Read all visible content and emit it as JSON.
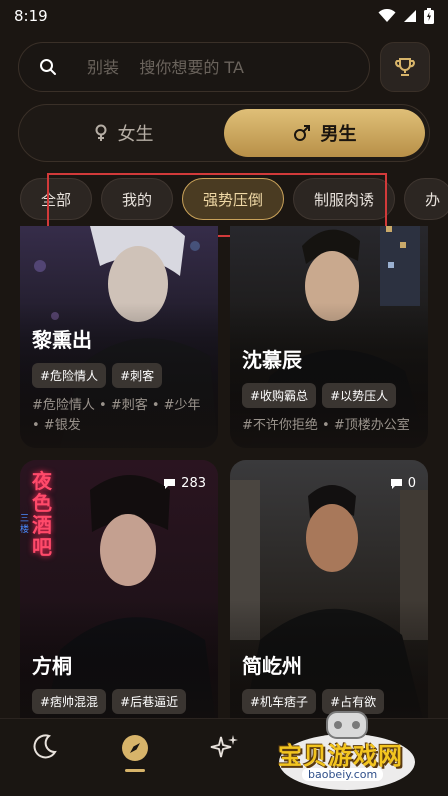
{
  "status_bar": {
    "time": "8:19"
  },
  "search": {
    "placeholder": "别装    搜你想要的 TA"
  },
  "gender": {
    "female_label": "女生",
    "male_label": "男生",
    "selected": "男生"
  },
  "categories": [
    {
      "label": "全部"
    },
    {
      "label": "我的"
    },
    {
      "label": "强势压倒",
      "active": true
    },
    {
      "label": "制服肉诱"
    },
    {
      "label": "办"
    }
  ],
  "cards": [
    {
      "name": "黎熏出",
      "tags": [
        "#危险情人",
        "#刺客"
      ],
      "description": "#危险情人 • #刺客 • #少年 • #银发"
    },
    {
      "name": "沈慕辰",
      "tags": [
        "#收购霸总",
        "#以势压人"
      ],
      "description": "#不许你拒绝 • #顶楼办公室"
    },
    {
      "name": "方桐",
      "count": "283",
      "tags": [
        "#痞帅混混",
        "#后巷逼近"
      ],
      "description": ""
    },
    {
      "name": "简屹州",
      "count": "0",
      "tags": [
        "#机车痞子",
        "#占有欲"
      ],
      "description": ""
    }
  ],
  "card_art_sign": {
    "line1": "夜色酒吧",
    "line2": "三楼"
  },
  "colors": {
    "accent": "#d7b46a",
    "background": "#1b1612",
    "highlight": "#d23a3a"
  },
  "icons": [
    "search-icon",
    "trophy-icon",
    "moon-icon",
    "compass-icon",
    "sparkle-icon"
  ],
  "watermark": {
    "text": "宝贝游戏网",
    "url": "baobeiy.com"
  }
}
